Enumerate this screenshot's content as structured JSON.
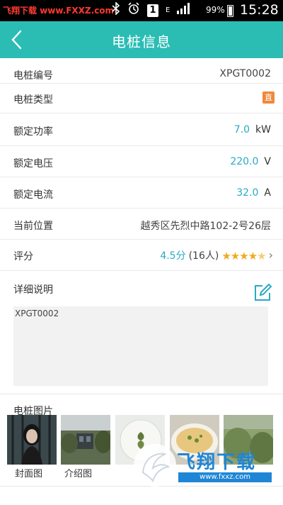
{
  "statusbar": {
    "watermark_text": "飞翔下载 www.FXXZ.com",
    "icons": [
      "bluetooth-icon",
      "alarm-icon",
      "sim-1-icon",
      "data-e-icon",
      "signal-icon"
    ],
    "sim_badge": "1",
    "battery": "99%",
    "battery_level": 0.99,
    "time": "15:28"
  },
  "header": {
    "title": "电桩信息",
    "back_icon": "chevron-left-icon",
    "bg": "#2bbdb4"
  },
  "rows": {
    "code": {
      "label": "电桩编号",
      "value": "XPGT0002"
    },
    "type": {
      "label": "电桩类型",
      "badge": "直",
      "badge_color": "#f0883a"
    },
    "power": {
      "label": "额定功率",
      "value": "7.0",
      "unit": "kW"
    },
    "voltage": {
      "label": "额定电压",
      "value": "220.0",
      "unit": "V"
    },
    "current": {
      "label": "额定电流",
      "value": "32.0",
      "unit": "A"
    },
    "location": {
      "label": "当前位置",
      "value": "越秀区先烈中路102-2号26层"
    },
    "rating": {
      "label": "评分",
      "score": "4.5分",
      "count": "(16人)",
      "stars": 4.5
    },
    "desc": {
      "label": "详细说明",
      "text": "XPGT0002"
    }
  },
  "photos": {
    "label": "电桩图片",
    "captions": [
      "封面图",
      "介绍图"
    ]
  },
  "watermark": {
    "brand": "飞翔下载",
    "url": "www.fxxz.com"
  }
}
